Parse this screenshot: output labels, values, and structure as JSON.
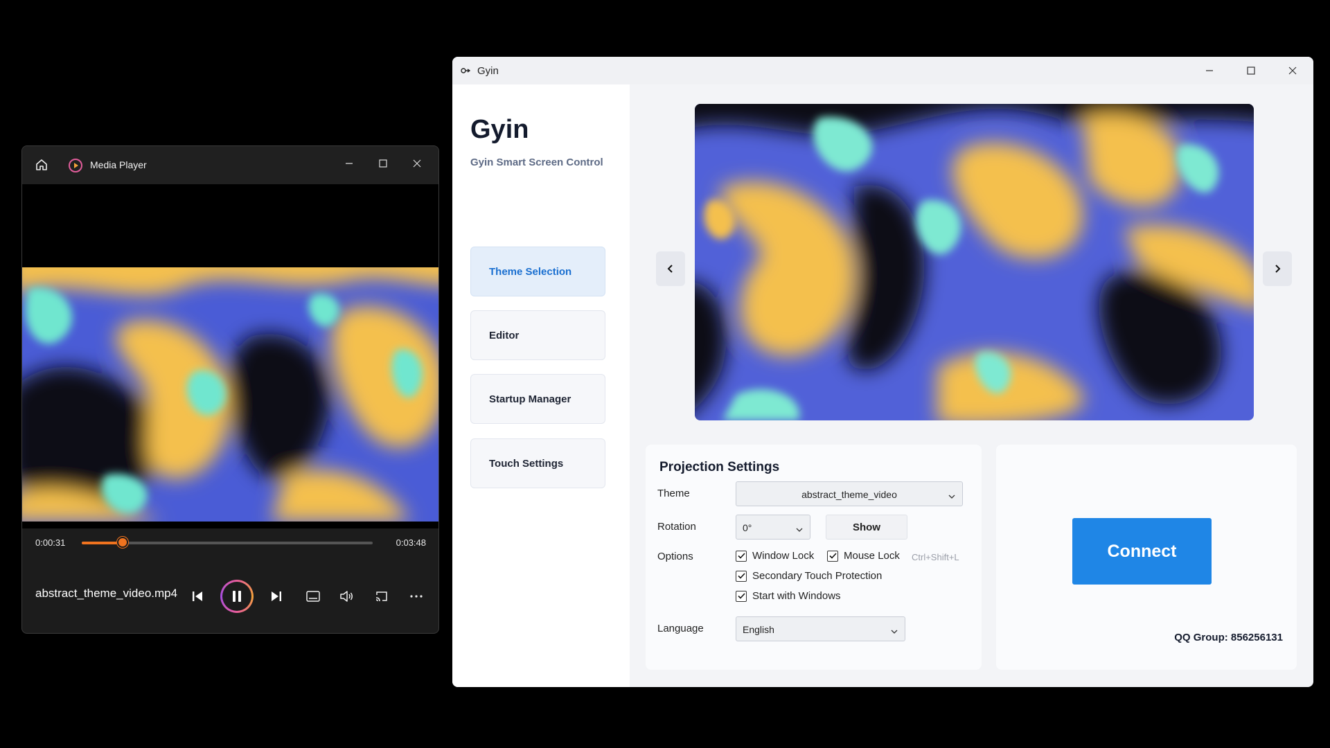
{
  "media_player": {
    "title": "Media Player",
    "current_time": "0:00:31",
    "total_time": "0:03:48",
    "progress_fraction": 0.14,
    "file_name": "abstract_theme_video.mp4",
    "accent_color": "#f0731f",
    "controls": [
      "previous-icon",
      "pause-icon",
      "next-icon",
      "subtitles-icon",
      "volume-icon",
      "cast-icon",
      "more-icon"
    ]
  },
  "gyin": {
    "window_title": "Gyin",
    "app_name": "Gyin",
    "subtitle": "Gyin Smart Screen Control",
    "nav": [
      {
        "label": "Theme Selection",
        "active": true
      },
      {
        "label": "Editor",
        "active": false
      },
      {
        "label": "Startup Manager",
        "active": false
      },
      {
        "label": "Touch Settings",
        "active": false
      }
    ],
    "projection": {
      "heading": "Projection Settings",
      "theme_label": "Theme",
      "theme_value": "abstract_theme_video",
      "rotation_label": "Rotation",
      "rotation_value": "0°",
      "show_button": "Show",
      "options_label": "Options",
      "options": {
        "window_lock": "Window Lock",
        "mouse_lock": "Mouse Lock",
        "mouse_lock_hint": "Ctrl+Shift+L",
        "secondary_touch": "Secondary Touch Protection",
        "start_with_windows": "Start with Windows"
      },
      "language_label": "Language",
      "language_value": "English"
    },
    "connect_label": "Connect",
    "qq_group": "QQ Group: 856256131",
    "accent_color": "#1f86e6"
  }
}
